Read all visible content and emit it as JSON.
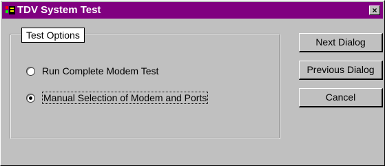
{
  "window": {
    "title": "TDV System Test",
    "close_icon": "×",
    "colors": {
      "titlebar": "#800080",
      "face": "#c0c0c0"
    }
  },
  "group": {
    "label": "Test Options"
  },
  "options": [
    {
      "label": "Run Complete Modem Test",
      "checked": false
    },
    {
      "label": "Manual Selection of Modem and Ports",
      "checked": true
    }
  ],
  "buttons": {
    "next": "Next Dialog",
    "previous": "Previous Dialog",
    "cancel": "Cancel"
  },
  "icons": {
    "app": "tdv-app-icon",
    "close": "close-icon"
  }
}
